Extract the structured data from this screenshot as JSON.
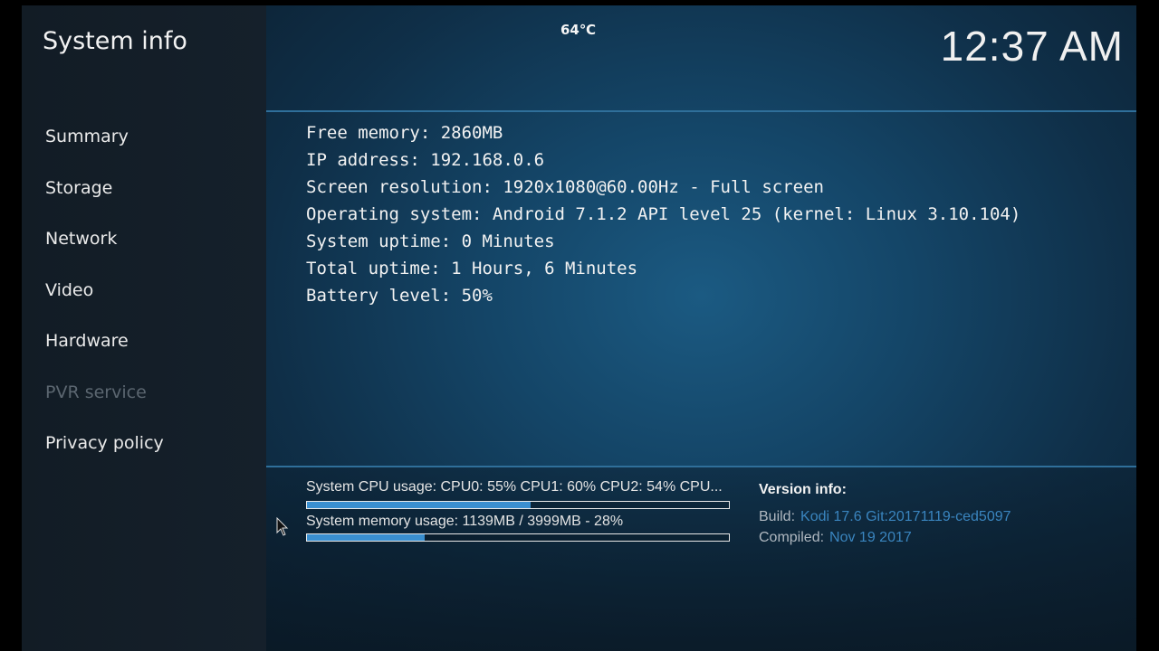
{
  "header": {
    "title": "System info",
    "temperature": "64℃",
    "clock": "12:37 AM"
  },
  "sidebar": {
    "items": [
      {
        "label": "Summary",
        "enabled": true
      },
      {
        "label": "Storage",
        "enabled": true
      },
      {
        "label": "Network",
        "enabled": true
      },
      {
        "label": "Video",
        "enabled": true
      },
      {
        "label": "Hardware",
        "enabled": true
      },
      {
        "label": "PVR service",
        "enabled": false
      },
      {
        "label": "Privacy policy",
        "enabled": true
      }
    ]
  },
  "info": {
    "lines": [
      "Free memory: 2860MB",
      "IP address: 192.168.0.6",
      "Screen resolution: 1920x1080@60.00Hz - Full screen",
      "Operating system: Android 7.1.2 API level 25 (kernel: Linux 3.10.104)",
      "System uptime: 0 Minutes",
      "Total uptime: 1 Hours, 6 Minutes",
      "Battery level: 50%"
    ]
  },
  "usage": {
    "cpu": {
      "label": "System CPU usage: CPU0:  55% CPU1:  60% CPU2:  54% CPU...",
      "percent": 53
    },
    "memory": {
      "label": "System memory usage: 1139MB / 3999MB - 28%",
      "percent": 28
    }
  },
  "version": {
    "title": "Version info:",
    "build_key": "Build:",
    "build_value": "Kodi 17.6 Git:20171119-ced5097",
    "compiled_key": "Compiled:",
    "compiled_value": "Nov 19 2017"
  },
  "colors": {
    "accent": "#3a8fd0",
    "divider": "#2f6f9a",
    "disabled_text": "#5b6670"
  },
  "icons": {
    "cursor": "mouse-pointer-icon"
  }
}
